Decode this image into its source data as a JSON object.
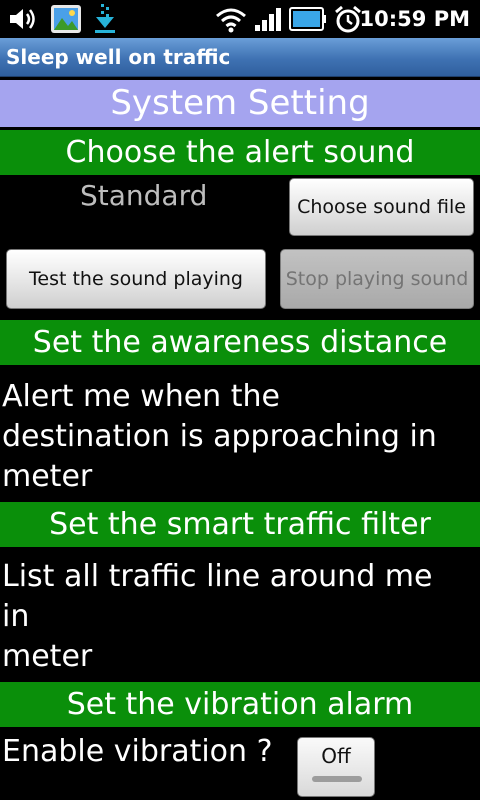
{
  "status_bar": {
    "time": "10:59 PM",
    "left_icons": [
      "volume-icon",
      "gallery-icon",
      "download-icon"
    ],
    "right_icons": [
      "wifi-icon",
      "signal-icon",
      "battery-icon",
      "alarm-icon"
    ]
  },
  "app": {
    "title": "Sleep well on traffic"
  },
  "page": {
    "heading": "System Setting"
  },
  "sound": {
    "header": "Choose the alert sound",
    "current": "Standard",
    "choose_button": "Choose sound file",
    "test_button": "Test the sound playing",
    "stop_button": "Stop playing sound"
  },
  "distance": {
    "header": "Set the awareness distance",
    "text": "Alert me when the\ndestination is approaching in\nmeter"
  },
  "filter": {
    "header": "Set the smart traffic filter",
    "text": "List all traffic line around me\nin\nmeter"
  },
  "vibration": {
    "header": "Set the vibration alarm",
    "label": "Enable vibration ?",
    "toggle_state": "Off"
  },
  "colors": {
    "section_header": "#0a8f0a",
    "system_header": "#a5a4ef",
    "title_bar": "#3f72b3"
  }
}
